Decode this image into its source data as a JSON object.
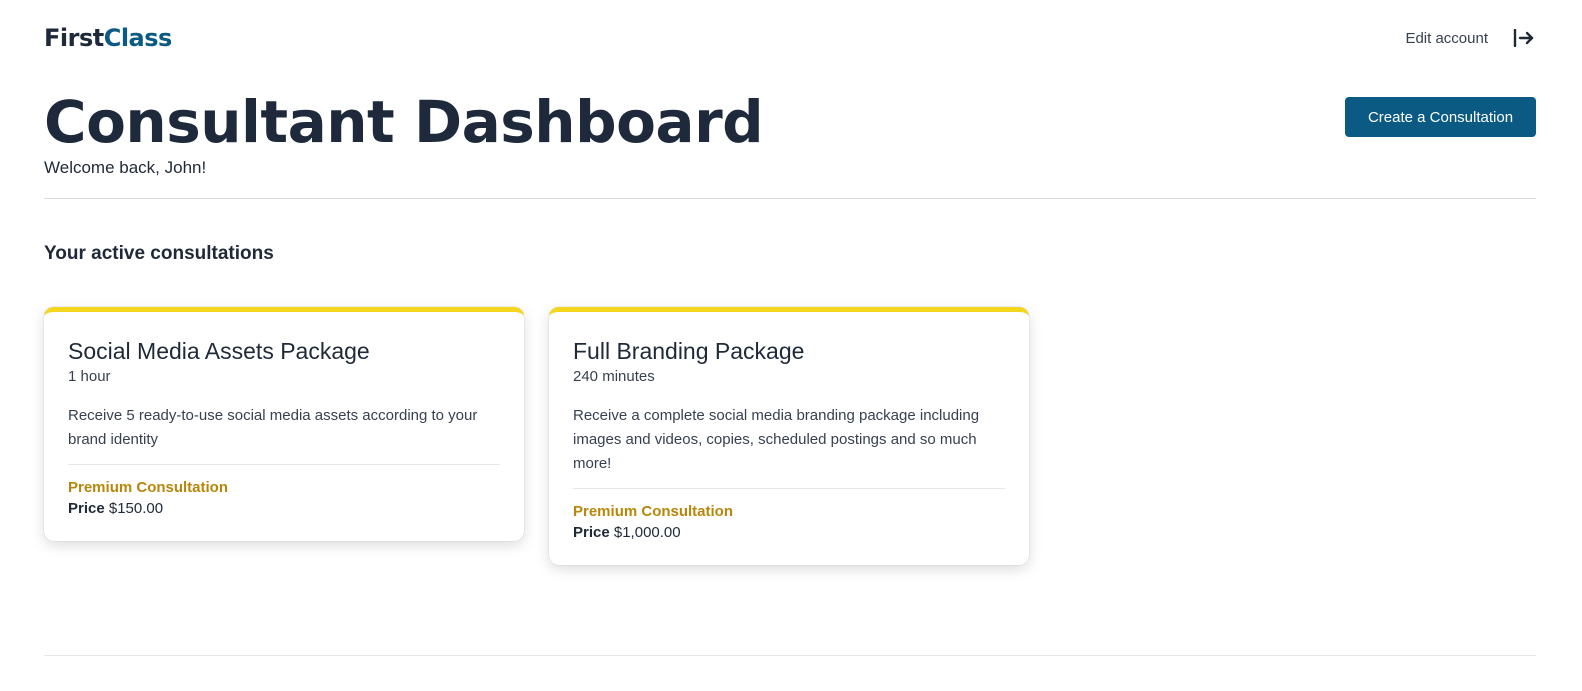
{
  "brand": {
    "part1": "First",
    "part2": "Class"
  },
  "nav": {
    "edit_account": "Edit account",
    "logout_icon": "logout-icon"
  },
  "header": {
    "title": "Consultant Dashboard",
    "welcome": "Welcome back, John!",
    "create_button": "Create a Consultation"
  },
  "section": {
    "title": "Your active consultations"
  },
  "cards": [
    {
      "title": "Social Media Assets Package",
      "duration": "1 hour",
      "description": "Receive 5 ready-to-use social media assets according to your brand identity",
      "tier": "Premium Consultation",
      "price_label": "Price",
      "price_value": "$150.00"
    },
    {
      "title": "Full Branding Package",
      "duration": "240 minutes",
      "description": "Receive a complete social media branding package including images and videos, copies, scheduled postings and so much more!",
      "tier": "Premium Consultation",
      "price_label": "Price",
      "price_value": "$1,000.00"
    }
  ],
  "colors": {
    "primary": "#0a5a84",
    "accent": "#f5d61f",
    "tier": "#b8860b",
    "heading": "#1e2a3b"
  }
}
